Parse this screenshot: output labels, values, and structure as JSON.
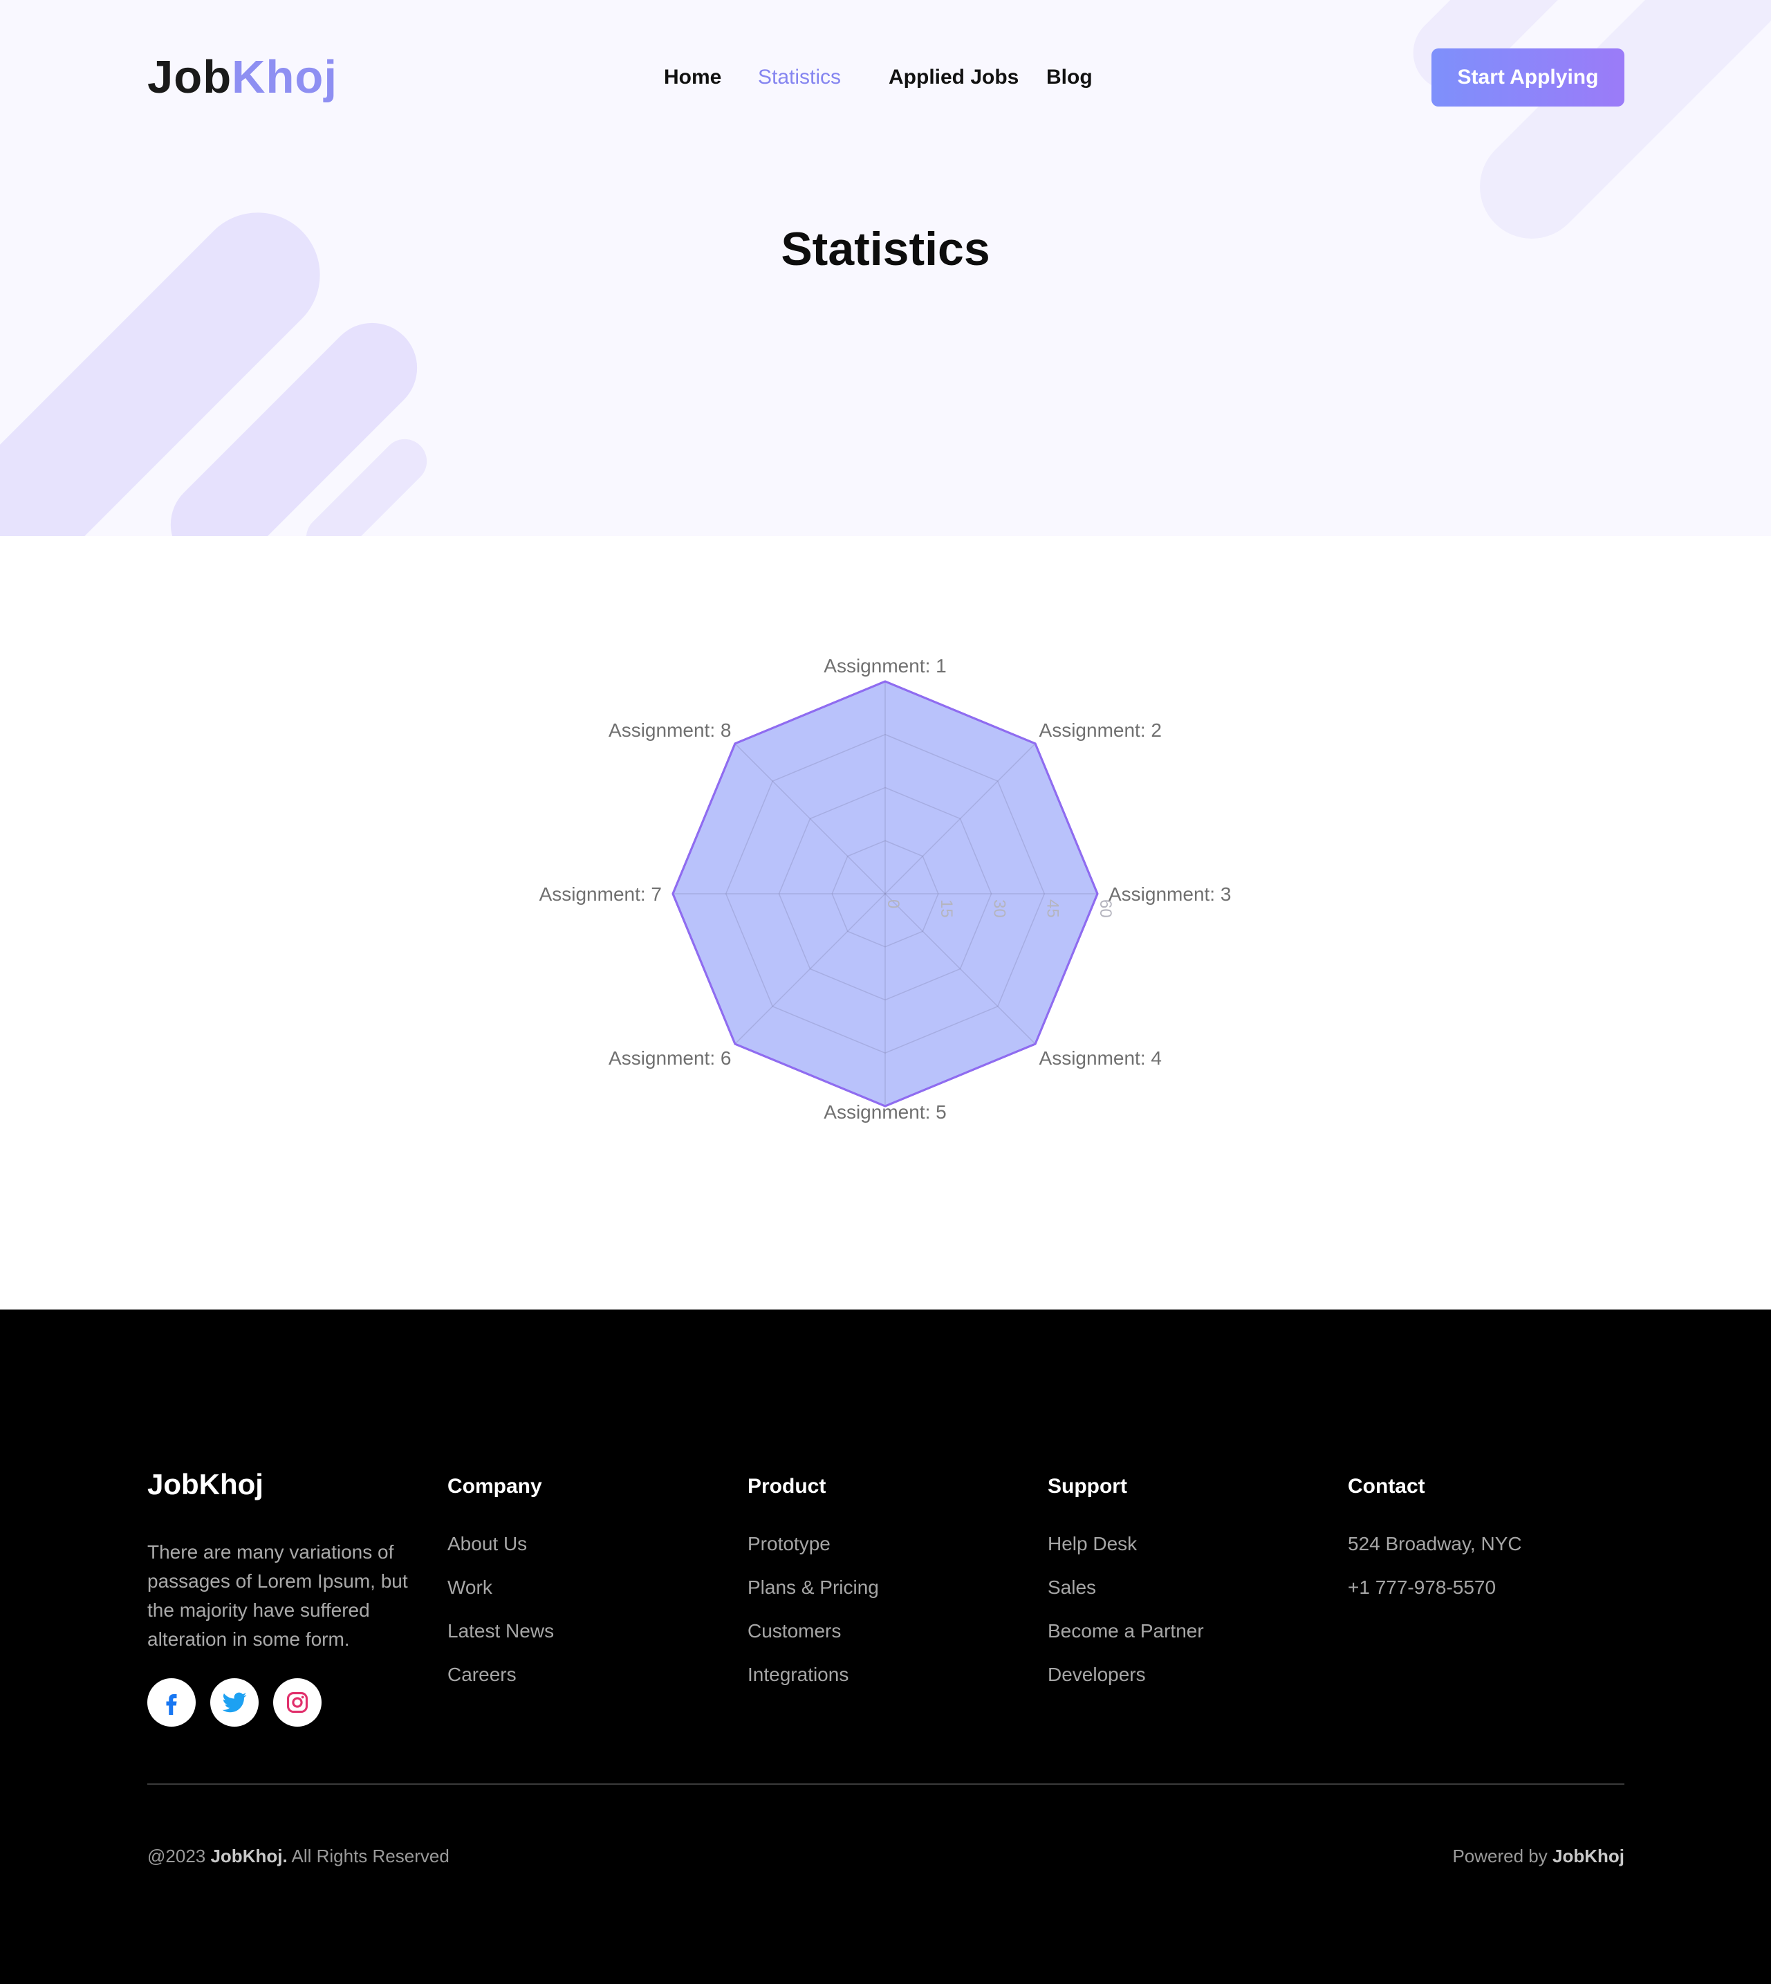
{
  "brand": {
    "logo_part1": "Job",
    "logo_part2": "Khoj",
    "accent": "#8e8ff2"
  },
  "nav": {
    "items": [
      {
        "label": "Home",
        "active": false
      },
      {
        "label": "Statistics",
        "active": true
      },
      {
        "label": "Applied Jobs",
        "active": false
      },
      {
        "label": "Blog",
        "active": false
      }
    ],
    "cta_label": "Start Applying"
  },
  "hero": {
    "title": "Statistics"
  },
  "chart_data": {
    "type": "radar",
    "categories": [
      "Assignment: 1",
      "Assignment: 2",
      "Assignment: 3",
      "Assignment: 4",
      "Assignment: 5",
      "Assignment: 6",
      "Assignment: 7",
      "Assignment: 8"
    ],
    "values": [
      60,
      60,
      60,
      60,
      60,
      60,
      60,
      60
    ],
    "ticks": [
      0,
      15,
      30,
      45,
      60
    ],
    "rlim": [
      0,
      60
    ],
    "fill_color": "#b9c2fb",
    "line_color": "#8f6cf0",
    "grid": true
  },
  "footer": {
    "logo": "JobKhoj",
    "description": "There are many variations of passages of Lorem Ipsum, but the majority have suffered alteration in some form.",
    "socials": [
      {
        "name": "facebook-icon",
        "color": "#1877f2"
      },
      {
        "name": "twitter-icon",
        "color": "#1da1f2"
      },
      {
        "name": "instagram-icon",
        "color": "#e1306c"
      }
    ],
    "columns": [
      {
        "title": "Company",
        "links": [
          "About Us",
          "Work",
          "Latest News",
          "Careers"
        ]
      },
      {
        "title": "Product",
        "links": [
          "Prototype",
          "Plans & Pricing",
          "Customers",
          "Integrations"
        ]
      },
      {
        "title": "Support",
        "links": [
          "Help Desk",
          "Sales",
          "Become a Partner",
          "Developers"
        ]
      },
      {
        "title": "Contact",
        "links": [
          "524 Broadway, NYC",
          "+1 777-978-5570"
        ]
      }
    ],
    "copyright_prefix": "@2023 ",
    "copyright_brand": "JobKhoj.",
    "copyright_suffix": " All Rights Reserved",
    "powered_prefix": "Powered by ",
    "powered_brand": "JobKhoj"
  }
}
